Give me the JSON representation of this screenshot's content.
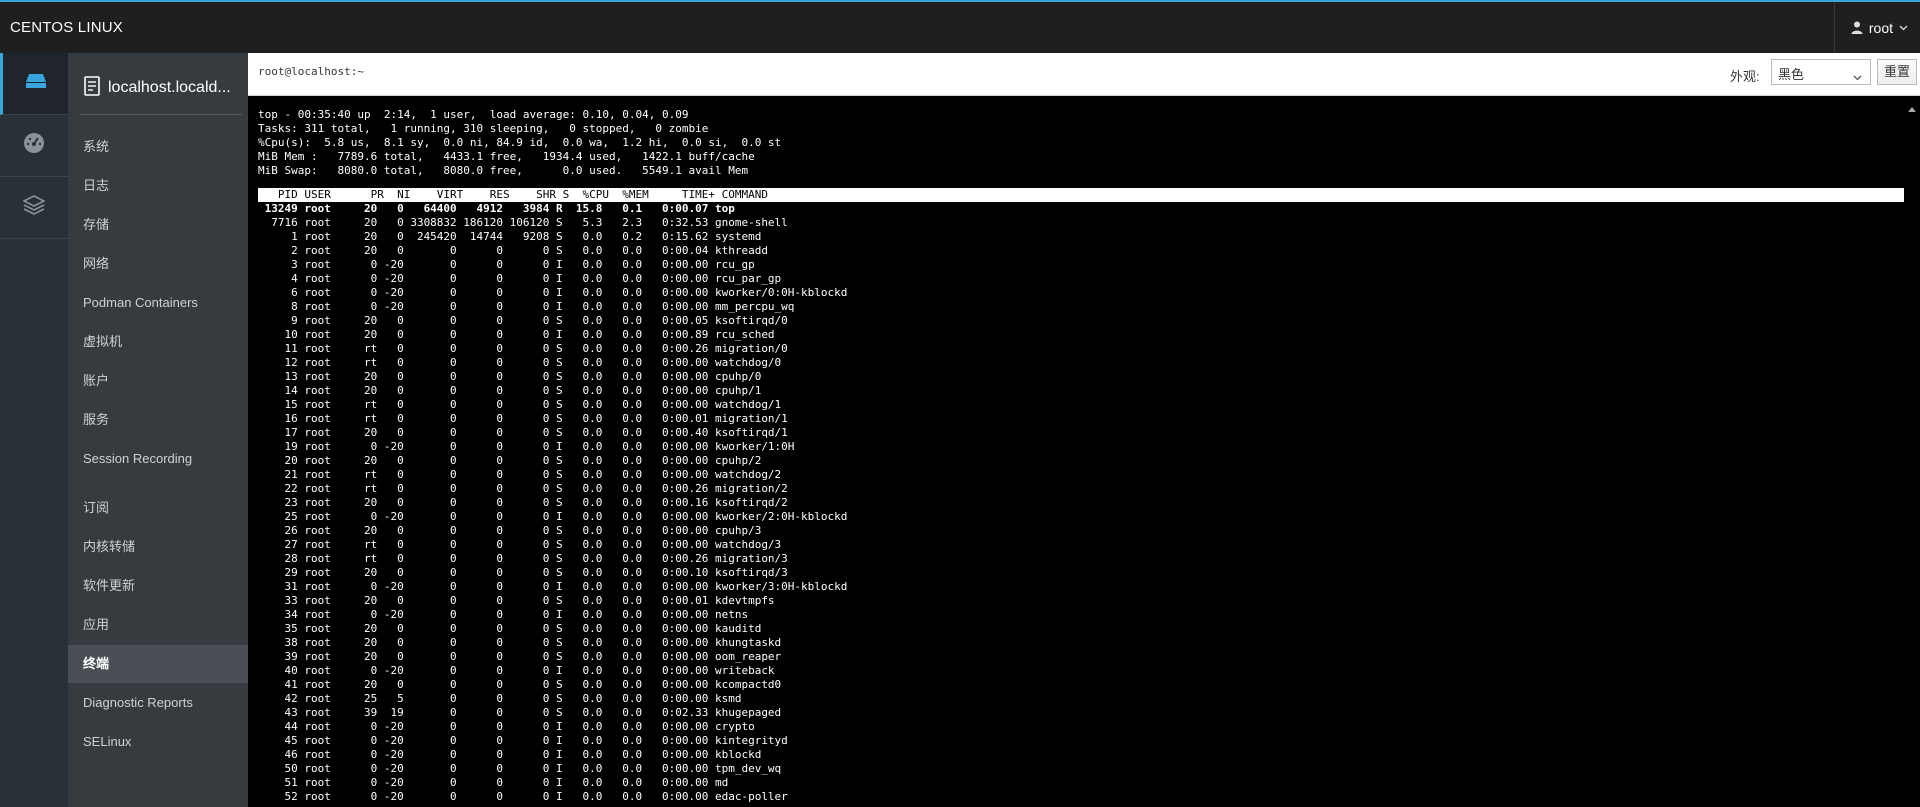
{
  "topbar": {
    "brand": "CENTOS LINUX",
    "user": "root"
  },
  "rail": {
    "items": [
      "dashboard-icon",
      "host-icon",
      "apps-icon"
    ]
  },
  "nav": {
    "host": "localhost.locald...",
    "items": [
      {
        "label": "系统"
      },
      {
        "label": "日志"
      },
      {
        "label": "存储"
      },
      {
        "label": "网络"
      },
      {
        "label": "Podman Containers"
      },
      {
        "label": "虚拟机"
      },
      {
        "label": "账户"
      },
      {
        "label": "服务"
      },
      {
        "label": "Session Recording"
      },
      {
        "label": "订阅"
      },
      {
        "label": "内核转储"
      },
      {
        "label": "软件更新"
      },
      {
        "label": "应用"
      },
      {
        "label": "终端",
        "active": true
      },
      {
        "label": "Diagnostic Reports"
      },
      {
        "label": "SELinux"
      }
    ]
  },
  "terminal": {
    "title": "root@localhost:~",
    "appearance_label": "外观:",
    "appearance_value": "黑色",
    "reset_label": "重置",
    "summary": [
      "top - 00:35:40 up  2:14,  1 user,  load average: 0.10, 0.04, 0.09",
      "Tasks: 311 total,   1 running, 310 sleeping,   0 stopped,   0 zombie",
      "%Cpu(s):  5.8 us,  8.1 sy,  0.0 ni, 84.9 id,  0.0 wa,  1.2 hi,  0.0 si,  0.0 st",
      "MiB Mem :   7789.6 total,   4433.1 free,   1934.4 used,   1422.1 buff/cache",
      "MiB Swap:   8080.0 total,   8080.0 free,      0.0 used.   5549.1 avail Mem"
    ],
    "header": "   PID USER      PR  NI    VIRT    RES    SHR S  %CPU  %MEM     TIME+ COMMAND",
    "processes": [
      [
        "13249",
        "root",
        "20",
        "0",
        "64400",
        "4912",
        "3984",
        "R",
        "15.8",
        "0.1",
        "0:00.07",
        "top"
      ],
      [
        "7716",
        "root",
        "20",
        "0",
        "3308832",
        "186120",
        "106120",
        "S",
        "5.3",
        "2.3",
        "0:32.53",
        "gnome-shell"
      ],
      [
        "1",
        "root",
        "20",
        "0",
        "245420",
        "14744",
        "9208",
        "S",
        "0.0",
        "0.2",
        "0:15.62",
        "systemd"
      ],
      [
        "2",
        "root",
        "20",
        "0",
        "0",
        "0",
        "0",
        "S",
        "0.0",
        "0.0",
        "0:00.04",
        "kthreadd"
      ],
      [
        "3",
        "root",
        "0",
        "-20",
        "0",
        "0",
        "0",
        "I",
        "0.0",
        "0.0",
        "0:00.00",
        "rcu_gp"
      ],
      [
        "4",
        "root",
        "0",
        "-20",
        "0",
        "0",
        "0",
        "I",
        "0.0",
        "0.0",
        "0:00.00",
        "rcu_par_gp"
      ],
      [
        "6",
        "root",
        "0",
        "-20",
        "0",
        "0",
        "0",
        "I",
        "0.0",
        "0.0",
        "0:00.00",
        "kworker/0:0H-kblockd"
      ],
      [
        "8",
        "root",
        "0",
        "-20",
        "0",
        "0",
        "0",
        "I",
        "0.0",
        "0.0",
        "0:00.00",
        "mm_percpu_wq"
      ],
      [
        "9",
        "root",
        "20",
        "0",
        "0",
        "0",
        "0",
        "S",
        "0.0",
        "0.0",
        "0:00.05",
        "ksoftirqd/0"
      ],
      [
        "10",
        "root",
        "20",
        "0",
        "0",
        "0",
        "0",
        "I",
        "0.0",
        "0.0",
        "0:00.89",
        "rcu_sched"
      ],
      [
        "11",
        "root",
        "rt",
        "0",
        "0",
        "0",
        "0",
        "S",
        "0.0",
        "0.0",
        "0:00.26",
        "migration/0"
      ],
      [
        "12",
        "root",
        "rt",
        "0",
        "0",
        "0",
        "0",
        "S",
        "0.0",
        "0.0",
        "0:00.00",
        "watchdog/0"
      ],
      [
        "13",
        "root",
        "20",
        "0",
        "0",
        "0",
        "0",
        "S",
        "0.0",
        "0.0",
        "0:00.00",
        "cpuhp/0"
      ],
      [
        "14",
        "root",
        "20",
        "0",
        "0",
        "0",
        "0",
        "S",
        "0.0",
        "0.0",
        "0:00.00",
        "cpuhp/1"
      ],
      [
        "15",
        "root",
        "rt",
        "0",
        "0",
        "0",
        "0",
        "S",
        "0.0",
        "0.0",
        "0:00.00",
        "watchdog/1"
      ],
      [
        "16",
        "root",
        "rt",
        "0",
        "0",
        "0",
        "0",
        "S",
        "0.0",
        "0.0",
        "0:00.01",
        "migration/1"
      ],
      [
        "17",
        "root",
        "20",
        "0",
        "0",
        "0",
        "0",
        "S",
        "0.0",
        "0.0",
        "0:00.40",
        "ksoftirqd/1"
      ],
      [
        "19",
        "root",
        "0",
        "-20",
        "0",
        "0",
        "0",
        "I",
        "0.0",
        "0.0",
        "0:00.00",
        "kworker/1:0H"
      ],
      [
        "20",
        "root",
        "20",
        "0",
        "0",
        "0",
        "0",
        "S",
        "0.0",
        "0.0",
        "0:00.00",
        "cpuhp/2"
      ],
      [
        "21",
        "root",
        "rt",
        "0",
        "0",
        "0",
        "0",
        "S",
        "0.0",
        "0.0",
        "0:00.00",
        "watchdog/2"
      ],
      [
        "22",
        "root",
        "rt",
        "0",
        "0",
        "0",
        "0",
        "S",
        "0.0",
        "0.0",
        "0:00.26",
        "migration/2"
      ],
      [
        "23",
        "root",
        "20",
        "0",
        "0",
        "0",
        "0",
        "S",
        "0.0",
        "0.0",
        "0:00.16",
        "ksoftirqd/2"
      ],
      [
        "25",
        "root",
        "0",
        "-20",
        "0",
        "0",
        "0",
        "I",
        "0.0",
        "0.0",
        "0:00.00",
        "kworker/2:0H-kblockd"
      ],
      [
        "26",
        "root",
        "20",
        "0",
        "0",
        "0",
        "0",
        "S",
        "0.0",
        "0.0",
        "0:00.00",
        "cpuhp/3"
      ],
      [
        "27",
        "root",
        "rt",
        "0",
        "0",
        "0",
        "0",
        "S",
        "0.0",
        "0.0",
        "0:00.00",
        "watchdog/3"
      ],
      [
        "28",
        "root",
        "rt",
        "0",
        "0",
        "0",
        "0",
        "S",
        "0.0",
        "0.0",
        "0:00.26",
        "migration/3"
      ],
      [
        "29",
        "root",
        "20",
        "0",
        "0",
        "0",
        "0",
        "S",
        "0.0",
        "0.0",
        "0:00.10",
        "ksoftirqd/3"
      ],
      [
        "31",
        "root",
        "0",
        "-20",
        "0",
        "0",
        "0",
        "I",
        "0.0",
        "0.0",
        "0:00.00",
        "kworker/3:0H-kblockd"
      ],
      [
        "33",
        "root",
        "20",
        "0",
        "0",
        "0",
        "0",
        "S",
        "0.0",
        "0.0",
        "0:00.01",
        "kdevtmpfs"
      ],
      [
        "34",
        "root",
        "0",
        "-20",
        "0",
        "0",
        "0",
        "I",
        "0.0",
        "0.0",
        "0:00.00",
        "netns"
      ],
      [
        "35",
        "root",
        "20",
        "0",
        "0",
        "0",
        "0",
        "S",
        "0.0",
        "0.0",
        "0:00.00",
        "kauditd"
      ],
      [
        "38",
        "root",
        "20",
        "0",
        "0",
        "0",
        "0",
        "S",
        "0.0",
        "0.0",
        "0:00.00",
        "khungtaskd"
      ],
      [
        "39",
        "root",
        "20",
        "0",
        "0",
        "0",
        "0",
        "S",
        "0.0",
        "0.0",
        "0:00.00",
        "oom_reaper"
      ],
      [
        "40",
        "root",
        "0",
        "-20",
        "0",
        "0",
        "0",
        "I",
        "0.0",
        "0.0",
        "0:00.00",
        "writeback"
      ],
      [
        "41",
        "root",
        "20",
        "0",
        "0",
        "0",
        "0",
        "S",
        "0.0",
        "0.0",
        "0:00.00",
        "kcompactd0"
      ],
      [
        "42",
        "root",
        "25",
        "5",
        "0",
        "0",
        "0",
        "S",
        "0.0",
        "0.0",
        "0:00.00",
        "ksmd"
      ],
      [
        "43",
        "root",
        "39",
        "19",
        "0",
        "0",
        "0",
        "S",
        "0.0",
        "0.0",
        "0:02.33",
        "khugepaged"
      ],
      [
        "44",
        "root",
        "0",
        "-20",
        "0",
        "0",
        "0",
        "I",
        "0.0",
        "0.0",
        "0:00.00",
        "crypto"
      ],
      [
        "45",
        "root",
        "0",
        "-20",
        "0",
        "0",
        "0",
        "I",
        "0.0",
        "0.0",
        "0:00.00",
        "kintegrityd"
      ],
      [
        "46",
        "root",
        "0",
        "-20",
        "0",
        "0",
        "0",
        "I",
        "0.0",
        "0.0",
        "0:00.00",
        "kblockd"
      ],
      [
        "50",
        "root",
        "0",
        "-20",
        "0",
        "0",
        "0",
        "I",
        "0.0",
        "0.0",
        "0:00.00",
        "tpm_dev_wq"
      ],
      [
        "51",
        "root",
        "0",
        "-20",
        "0",
        "0",
        "0",
        "I",
        "0.0",
        "0.0",
        "0:00.00",
        "md"
      ],
      [
        "52",
        "root",
        "0",
        "-20",
        "0",
        "0",
        "0",
        "I",
        "0.0",
        "0.0",
        "0:00.00",
        "edac-poller"
      ]
    ]
  }
}
